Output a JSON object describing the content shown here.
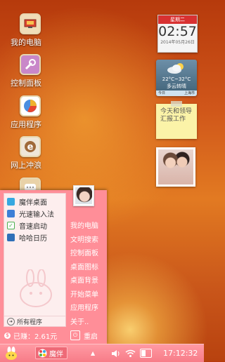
{
  "desktop": {
    "icons": [
      {
        "label": "我的电脑",
        "icon": "computer-icon"
      },
      {
        "label": "控制面板",
        "icon": "control-panel-icon"
      },
      {
        "label": "应用程序",
        "icon": "applications-icon"
      },
      {
        "label": "网上冲浪",
        "icon": "browser-icon"
      },
      {
        "label": "",
        "icon": "message-icon"
      }
    ]
  },
  "widgets": {
    "clock": {
      "day": "星期二",
      "time": "02:57",
      "date": "2014年05月26日"
    },
    "weather": {
      "temp": "22°C~32°C",
      "condition": "多云转晴",
      "today": "今日",
      "city": "上海市"
    },
    "note": {
      "text": "今天和领导汇报工作"
    },
    "photo": {
      "icon": "photo-frame-icon"
    }
  },
  "start_menu": {
    "apps": [
      {
        "label": "魔伴桌面",
        "icon": "mobanzhuomian-icon",
        "color": "#37a8e0"
      },
      {
        "label": "光速输入法",
        "icon": "input-method-icon",
        "color": "#3d7fd6"
      },
      {
        "label": "音速启动",
        "icon": "launcher-icon",
        "color": "#4caf50"
      },
      {
        "label": "哈哈日历",
        "icon": "calendar-icon",
        "color": "#2f6fb8"
      }
    ],
    "all_programs": "所有程序",
    "links": [
      "我的电脑",
      "文明搜索",
      "控制面板",
      "桌面图标",
      "桌面背景",
      "开始菜单",
      "应用程序",
      "关于.."
    ],
    "earned": "已赚：2.61元",
    "reboot": "重启"
  },
  "taskbar": {
    "task": "魔伴",
    "time": "17:12:32"
  },
  "colors": {
    "accent": "#ff8e98",
    "taskbar": "#f77c88"
  }
}
